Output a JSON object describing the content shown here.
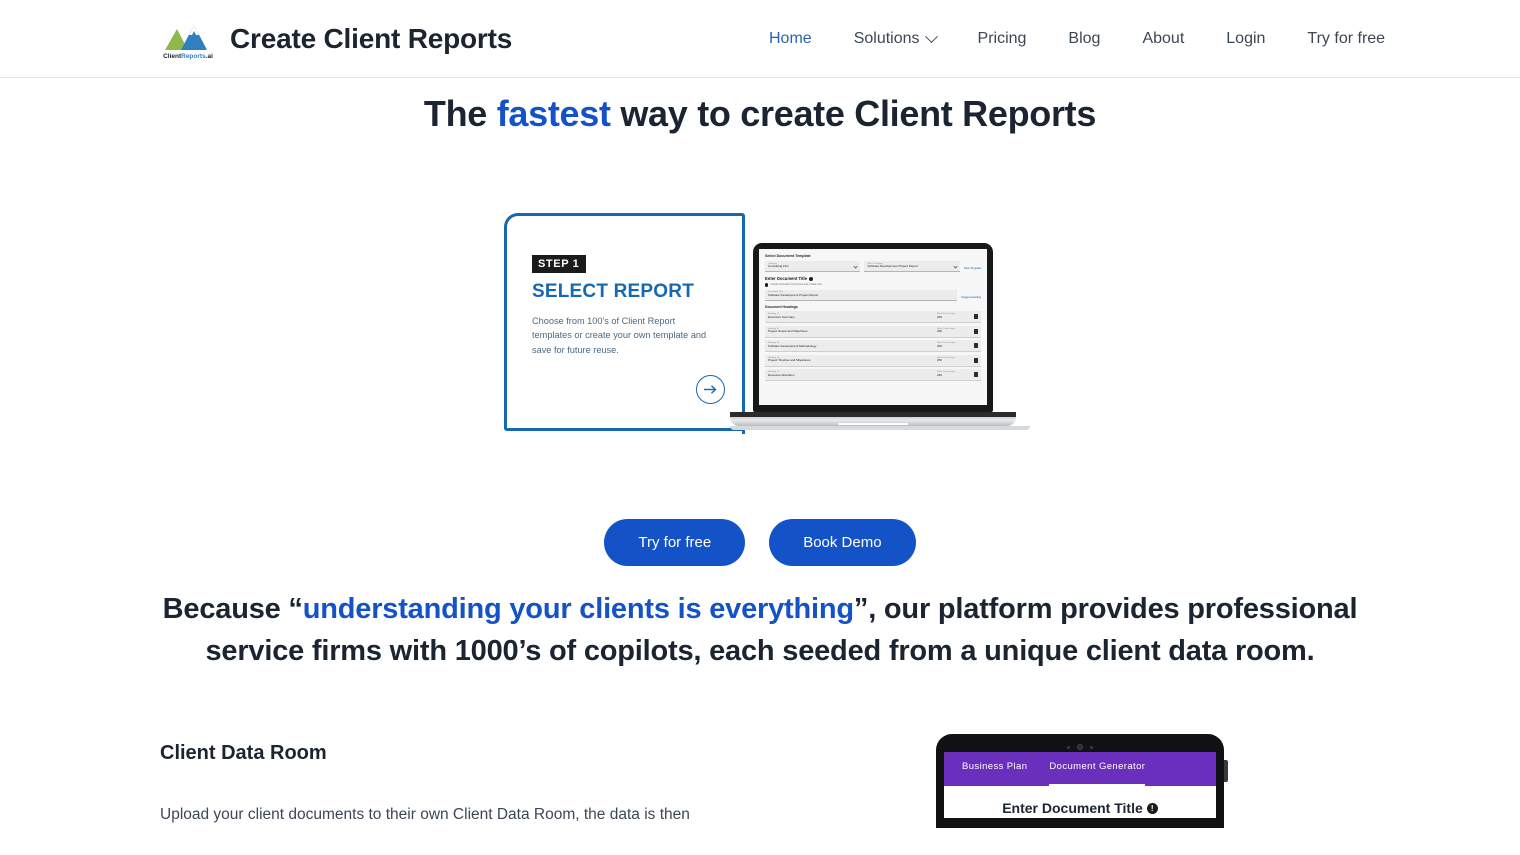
{
  "header": {
    "brand_title": "Create Client Reports",
    "logo_text": "ClientReports.ai",
    "nav": [
      {
        "label": "Home",
        "active": true
      },
      {
        "label": "Solutions",
        "has_chevron": true
      },
      {
        "label": "Pricing"
      },
      {
        "label": "Blog"
      },
      {
        "label": "About"
      },
      {
        "label": "Login"
      },
      {
        "label": "Try for free"
      }
    ]
  },
  "hero": {
    "headline_part1": "The ",
    "headline_highlight": "fastest",
    "headline_part2": " way to create Client Reports",
    "card": {
      "step_badge": "STEP 1",
      "step_title": "SELECT REPORT",
      "step_desc": "Choose from 100's of Client Report templates or create your own template and save for future reuse.",
      "arrow_icon": "arrow-right-icon"
    },
    "laptop_ui": {
      "section_title": "Select Document Template",
      "category_label": "Category",
      "category_value": "Consulting Firm",
      "template_label": "Select Template",
      "template_value": "Software Development Project Report",
      "save_template_link": "Save Template",
      "enter_title_heading": "Enter Document Title",
      "checkbox_label": "Include Information From Documents in Data room",
      "doc_title_label": "Document Title",
      "doc_title_value": "Software Development Project Report",
      "suggest_link": "Suggest Heading",
      "headings_title": "Document Headings",
      "heading_rows": [
        {
          "label": "Heading #1",
          "name": "Executive Summary",
          "wc_label": "Word Count Target",
          "wc": "200"
        },
        {
          "label": "Heading #2",
          "name": "Project Scope and Objectives",
          "wc_label": "Word Count Target",
          "wc": "300"
        },
        {
          "label": "Heading #3",
          "name": "Software Development Methodology",
          "wc_label": "Word Count Target",
          "wc": "300"
        },
        {
          "label": "Heading #4",
          "name": "Project Timeline and Milestones",
          "wc_label": "Word Count Target",
          "wc": "250"
        },
        {
          "label": "Heading #5",
          "name": "Resource Allocation",
          "wc_label": "Word Count Target",
          "wc": "250"
        }
      ],
      "delete_icon": "trash-icon"
    }
  },
  "cta": {
    "primary_label": "Try for free",
    "secondary_label": "Book Demo"
  },
  "subhead": {
    "part1": "Because “",
    "highlight": "understanding your clients is everything",
    "part2": "”, our platform provides professional service firms with 1000’s of copilots, each seeded from a unique client data room."
  },
  "lower": {
    "heading": "Client Data Room",
    "paragraph": "Upload your client documents to their own Client Data Room, the data is then",
    "tablet": {
      "tabs": [
        {
          "label": "Business Plan",
          "active": false
        },
        {
          "label": "Document Generator",
          "active": true
        }
      ],
      "title": "Enter Document Title",
      "info_icon": "info-icon"
    }
  },
  "colors": {
    "accent_blue": "#1452c8",
    "nav_active": "#2d62ad",
    "frame_blue": "#1668b3",
    "purple": "#6b2fbd",
    "text_dark": "#1b2430"
  }
}
